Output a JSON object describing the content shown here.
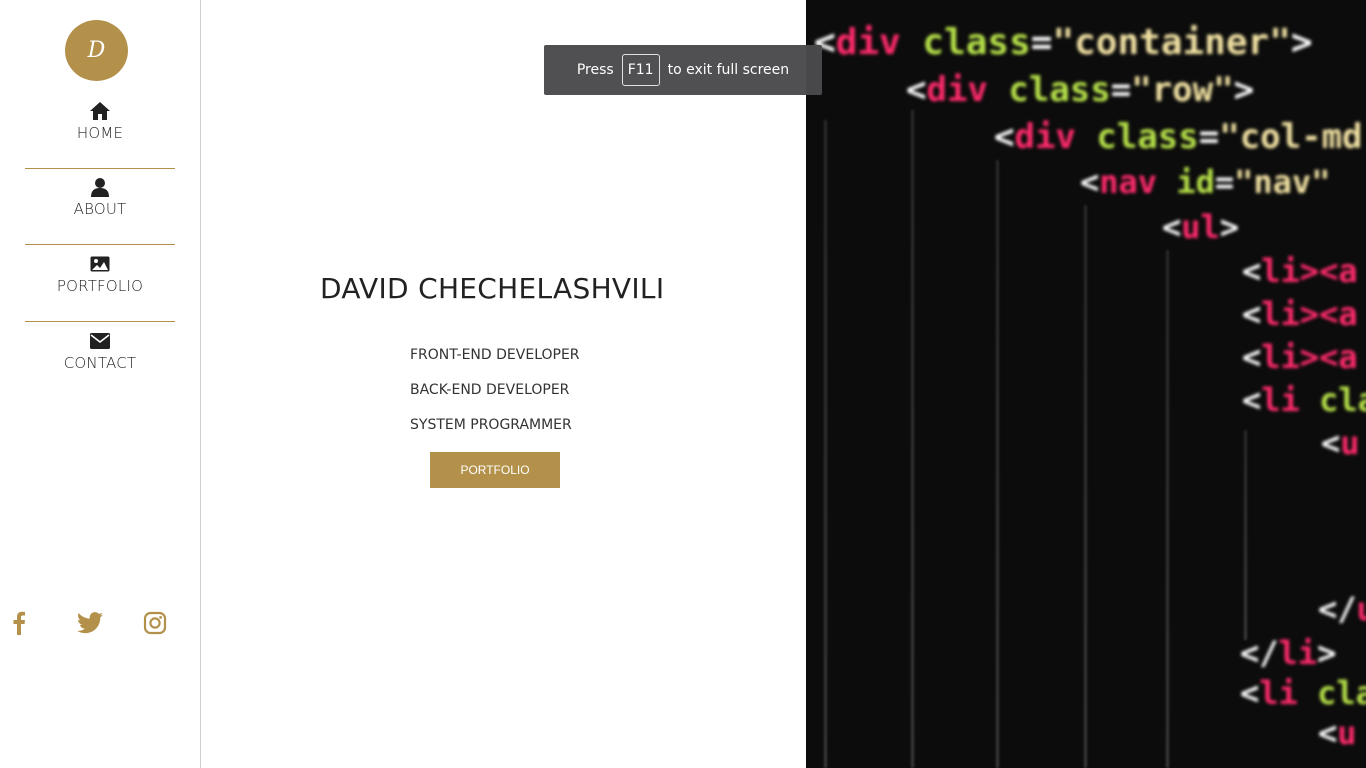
{
  "sidebar": {
    "logo_letter": "D",
    "accent_color": "#b3914a",
    "nav": [
      {
        "label": "HOME",
        "icon": "home-icon"
      },
      {
        "label": "ABOUT",
        "icon": "user-icon"
      },
      {
        "label": "PORTFOLIO",
        "icon": "image-icon"
      },
      {
        "label": "CONTACT",
        "icon": "envelope-icon"
      }
    ],
    "social": [
      "facebook-icon",
      "twitter-icon",
      "instagram-icon"
    ]
  },
  "hero": {
    "name": "DAVID CHECHELASHVILI",
    "roles": [
      "FRONT-END DEVELOPER",
      "BACK-END DEVELOPER",
      "SYSTEM PROGRAMMER"
    ],
    "button_label": "PORTFOLIO"
  },
  "code_image": {
    "lines": [
      [
        "<",
        "div",
        " class",
        "=",
        "\"container\"",
        ">"
      ],
      [
        "<",
        "div",
        " class",
        "=",
        "\"row\"",
        ">"
      ],
      [
        "<",
        "div",
        " class",
        "=",
        "\"col-md",
        ""
      ],
      [
        "<",
        "nav",
        " id",
        "=",
        "\"nav\"",
        ""
      ],
      [
        "<",
        "ul",
        "",
        "",
        "",
        ">"
      ],
      [
        "<",
        "li",
        "",
        "",
        "",
        "><a"
      ],
      [
        "<",
        "li",
        "",
        "",
        "",
        "><a"
      ],
      [
        "<",
        "li",
        "",
        "",
        "",
        "><a"
      ],
      [
        "<",
        "li",
        " cla",
        "",
        "",
        ""
      ],
      [
        "<",
        "u",
        "",
        "",
        "",
        ""
      ],
      [
        "</",
        "u",
        "",
        "",
        "",
        ""
      ],
      [
        "</",
        "li",
        "",
        "",
        "",
        ">"
      ],
      [
        "<",
        "li",
        " cla",
        "",
        "",
        ""
      ],
      [
        "<",
        "u",
        "",
        "",
        "",
        ""
      ]
    ]
  },
  "toast": {
    "prefix": "Press",
    "key": "F11",
    "suffix": "to exit full screen"
  }
}
